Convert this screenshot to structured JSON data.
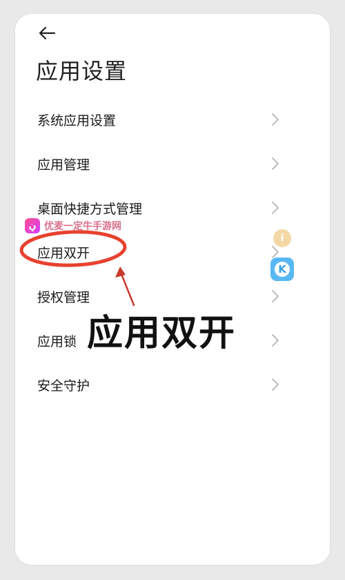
{
  "header": {
    "back_icon": "arrow-left-icon",
    "title": "应用设置"
  },
  "menu": {
    "items": [
      {
        "label": "系统应用设置",
        "chevron_icon": "chevron-right-icon"
      },
      {
        "label": "应用管理",
        "chevron_icon": "chevron-right-icon"
      },
      {
        "label": "桌面快捷方式管理",
        "chevron_icon": "chevron-right-icon"
      },
      {
        "label": "应用双开",
        "chevron_icon": "chevron-right-icon"
      },
      {
        "label": "授权管理",
        "chevron_icon": "chevron-right-icon"
      },
      {
        "label": "应用锁",
        "chevron_icon": "chevron-right-icon"
      },
      {
        "label": "安全守护",
        "chevron_icon": "chevron-right-icon"
      }
    ]
  },
  "annotation": {
    "caption": "应用双开",
    "highlight_color": "#e8412f"
  },
  "watermark": {
    "logo_text": "ڼ",
    "text": "优麦一定牛手游网"
  },
  "floating": {
    "badge_text": "i",
    "app_letter": "K"
  },
  "colors": {
    "background": "#ffffff",
    "text": "#1a1a1a",
    "chevron": "#b5b5b5",
    "accent": "#e8412f"
  }
}
